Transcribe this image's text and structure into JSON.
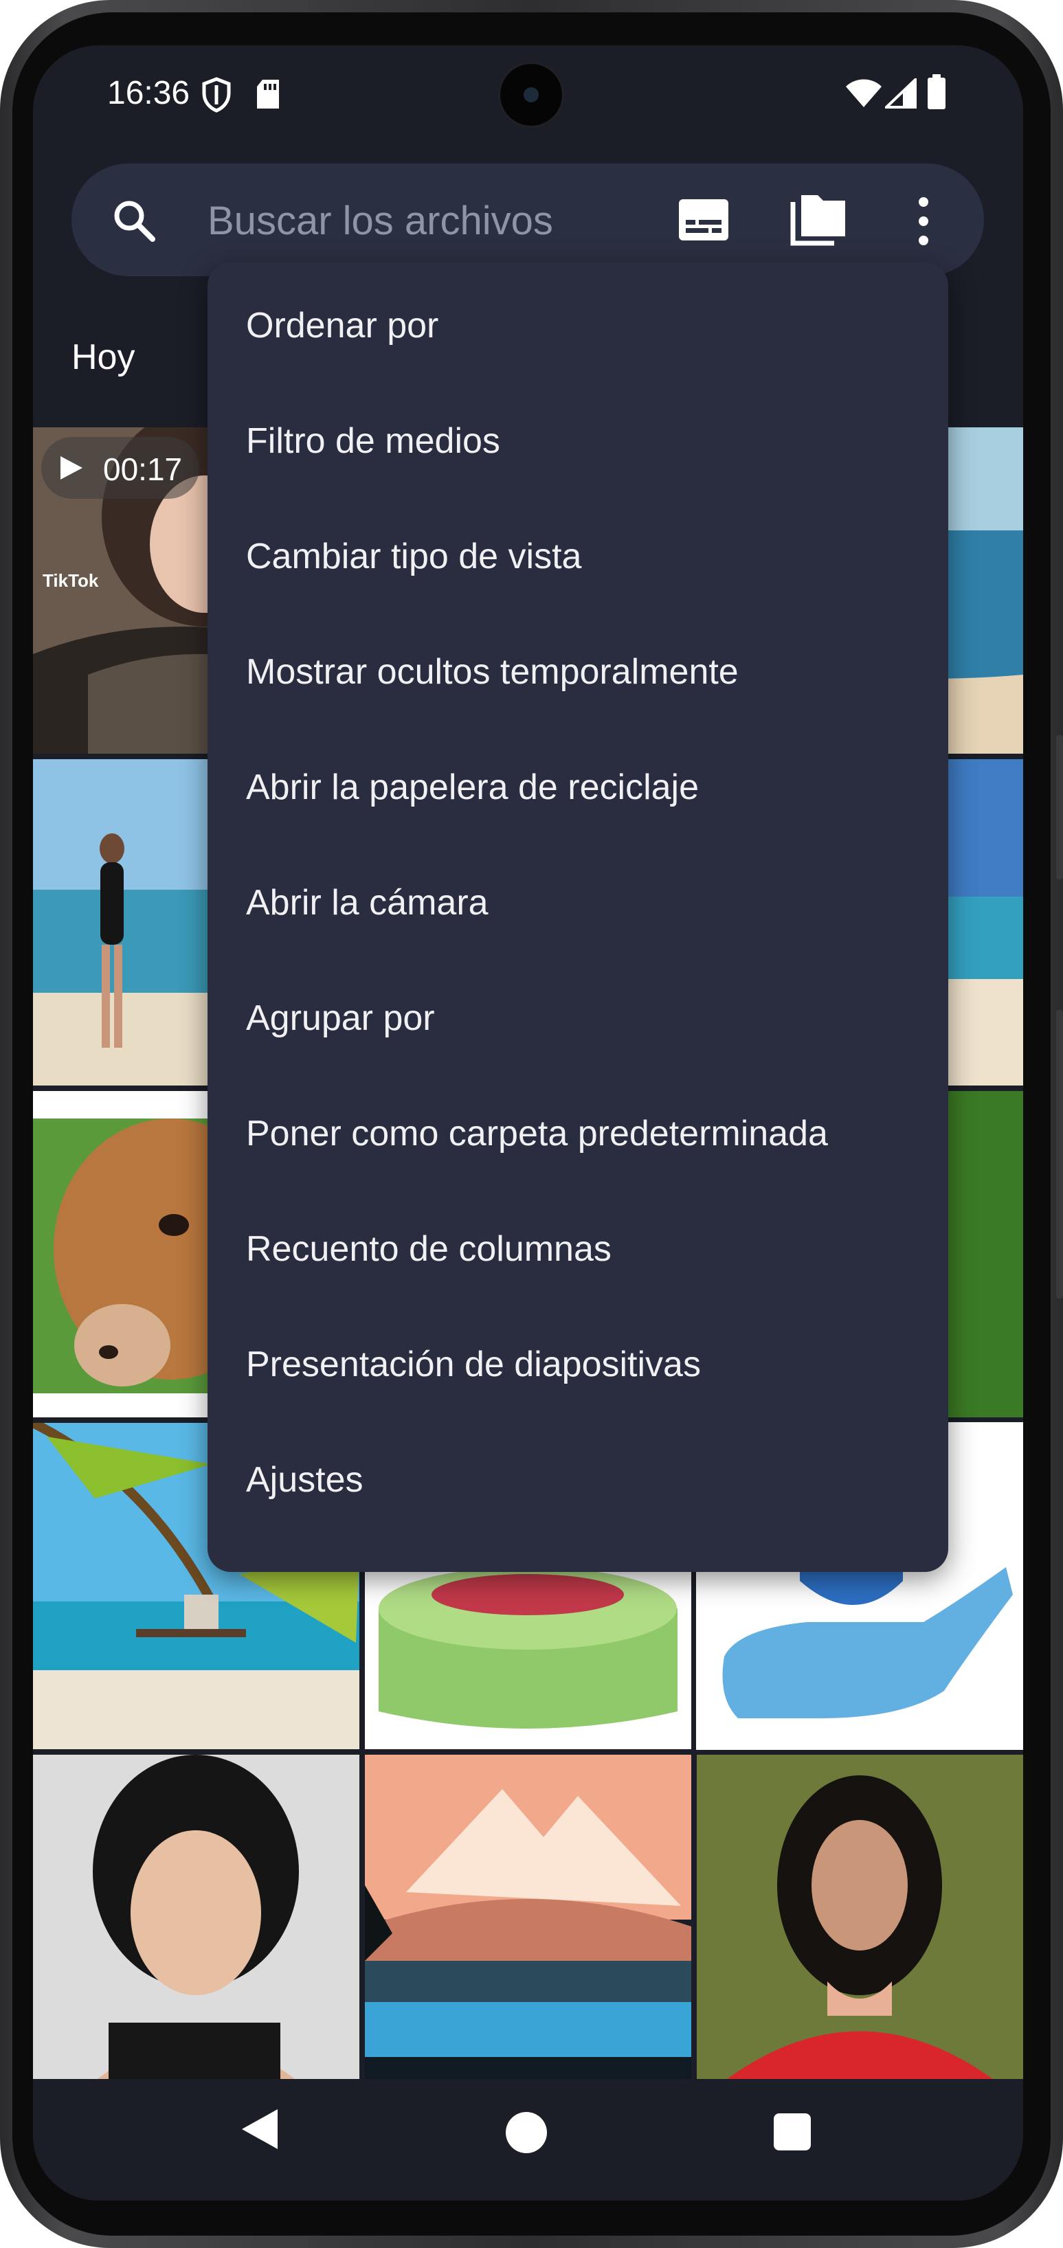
{
  "status_bar": {
    "time": "16:36"
  },
  "search": {
    "placeholder": "Buscar los archivos"
  },
  "header": {
    "date_label": "Hoy"
  },
  "grid": {
    "video": {
      "duration": "00:17",
      "watermark": "TikTok"
    }
  },
  "menu": {
    "items": [
      {
        "label": "Ordenar por"
      },
      {
        "label": "Filtro de medios"
      },
      {
        "label": "Cambiar tipo de vista"
      },
      {
        "label": "Mostrar ocultos temporalmente"
      },
      {
        "label": "Abrir la papelera de reciclaje"
      },
      {
        "label": "Abrir la cámara"
      },
      {
        "label": "Agrupar por"
      },
      {
        "label": "Poner como carpeta predeterminada"
      },
      {
        "label": "Recuento de columnas"
      },
      {
        "label": "Presentación de diapositivas"
      },
      {
        "label": "Ajustes"
      }
    ]
  },
  "icons": [
    "search-icon",
    "subtitles-icon",
    "folder-icon",
    "more-vert-icon",
    "shield-icon",
    "sd-card-icon",
    "wifi-icon",
    "signal-icon",
    "battery-icon",
    "play-icon",
    "back-icon",
    "home-icon",
    "recents-icon"
  ],
  "colors": {
    "background": "#1b1d27",
    "search_bar": "#2b2f42",
    "menu": "#2a2d40",
    "text": "#f1f1f4",
    "placeholder": "#8f95a9"
  }
}
